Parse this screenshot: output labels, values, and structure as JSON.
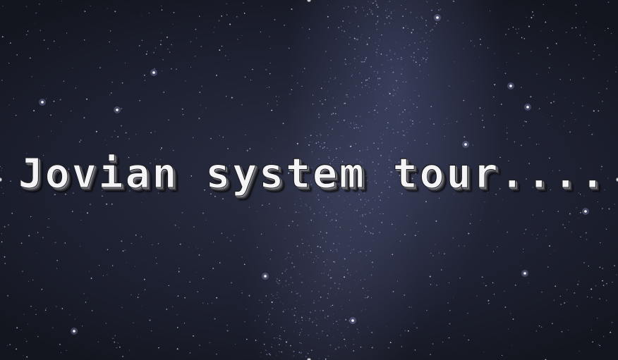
{
  "slide": {
    "title": "Jovian system tour...."
  },
  "colors": {
    "sky_dark": "#1b1e2d",
    "milky_way": "#8c96c8",
    "title_text": "#f4f4f6"
  }
}
